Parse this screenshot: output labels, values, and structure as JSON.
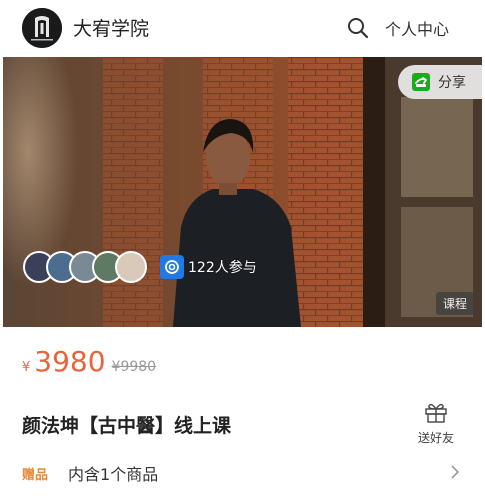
{
  "header": {
    "logo_text": "大宥学院",
    "brand_name": "大宥学院",
    "user_center": "个人中心",
    "icons": {
      "search": "search-icon"
    }
  },
  "hero": {
    "share_label": "分享",
    "participants_text": "122人参与",
    "tag": "课程",
    "colors": {
      "share_icon": "#1aad19"
    }
  },
  "product": {
    "currency": "¥",
    "price": "3980",
    "original_price": "¥9980",
    "title": "颜法坤【古中醫】线上课",
    "gift_label": "送好友",
    "bonus_tag": "赠品",
    "bonus_text": "内含1个商品"
  },
  "colors": {
    "accent": "#e8643c",
    "bonus": "#e8893c"
  }
}
